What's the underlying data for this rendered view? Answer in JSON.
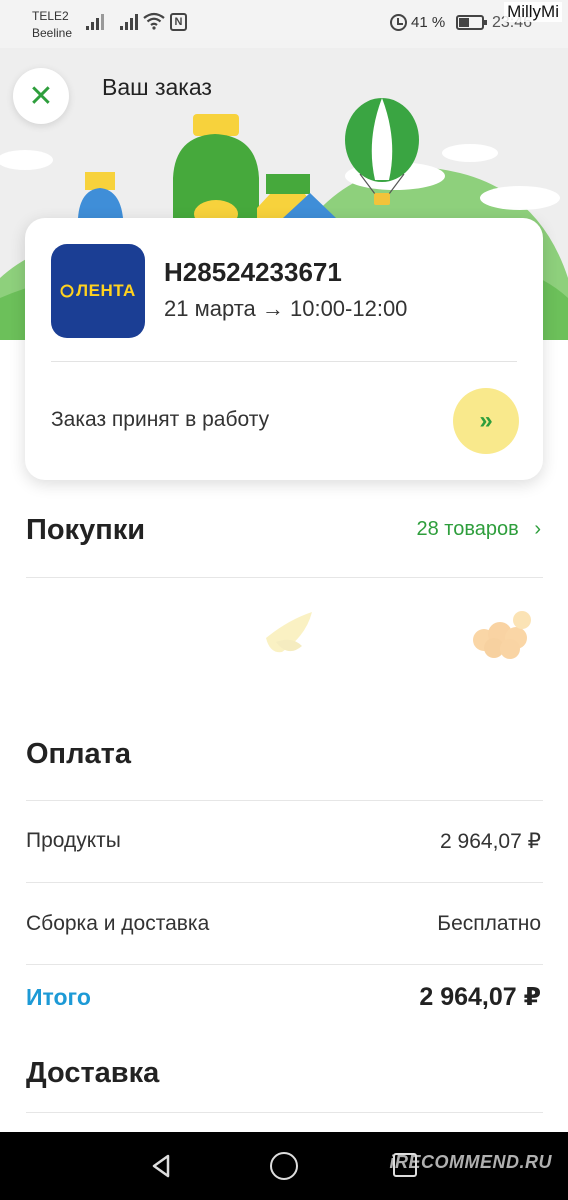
{
  "status_bar": {
    "carrier_1": "TELE2",
    "carrier_2": "Beeline",
    "battery_percent": "41 %",
    "time": "23:46",
    "watermark_user": "MillyMi"
  },
  "header": {
    "title": "Ваш заказ",
    "close_icon": "close-icon"
  },
  "order": {
    "store_logo_text": "ЛЕНТА",
    "number": "H28524233671",
    "delivery_slot": "21 марта → 10:00-12:00",
    "status": "Заказ принят в работу",
    "status_icon": "double-chevron-right-icon"
  },
  "purchases": {
    "title": "Покупки",
    "count_label": "28 товаров"
  },
  "payment": {
    "title": "Оплата",
    "rows": [
      {
        "label": "Продукты",
        "value": "2  964,07 ₽"
      },
      {
        "label": "Сборка и доставка",
        "value": "Бесплатно"
      }
    ],
    "total_label": "Итого",
    "total_value": "2  964,07 ₽"
  },
  "delivery": {
    "title": "Доставка"
  },
  "footer": {
    "watermark": "iRECOMMEND.RU"
  },
  "colors": {
    "accent_green": "#2e9e3c",
    "total_blue": "#1d9ad6",
    "store_blue": "#1b3e94",
    "store_yellow": "#ffd21f",
    "status_button_yellow": "#f9e98c"
  }
}
